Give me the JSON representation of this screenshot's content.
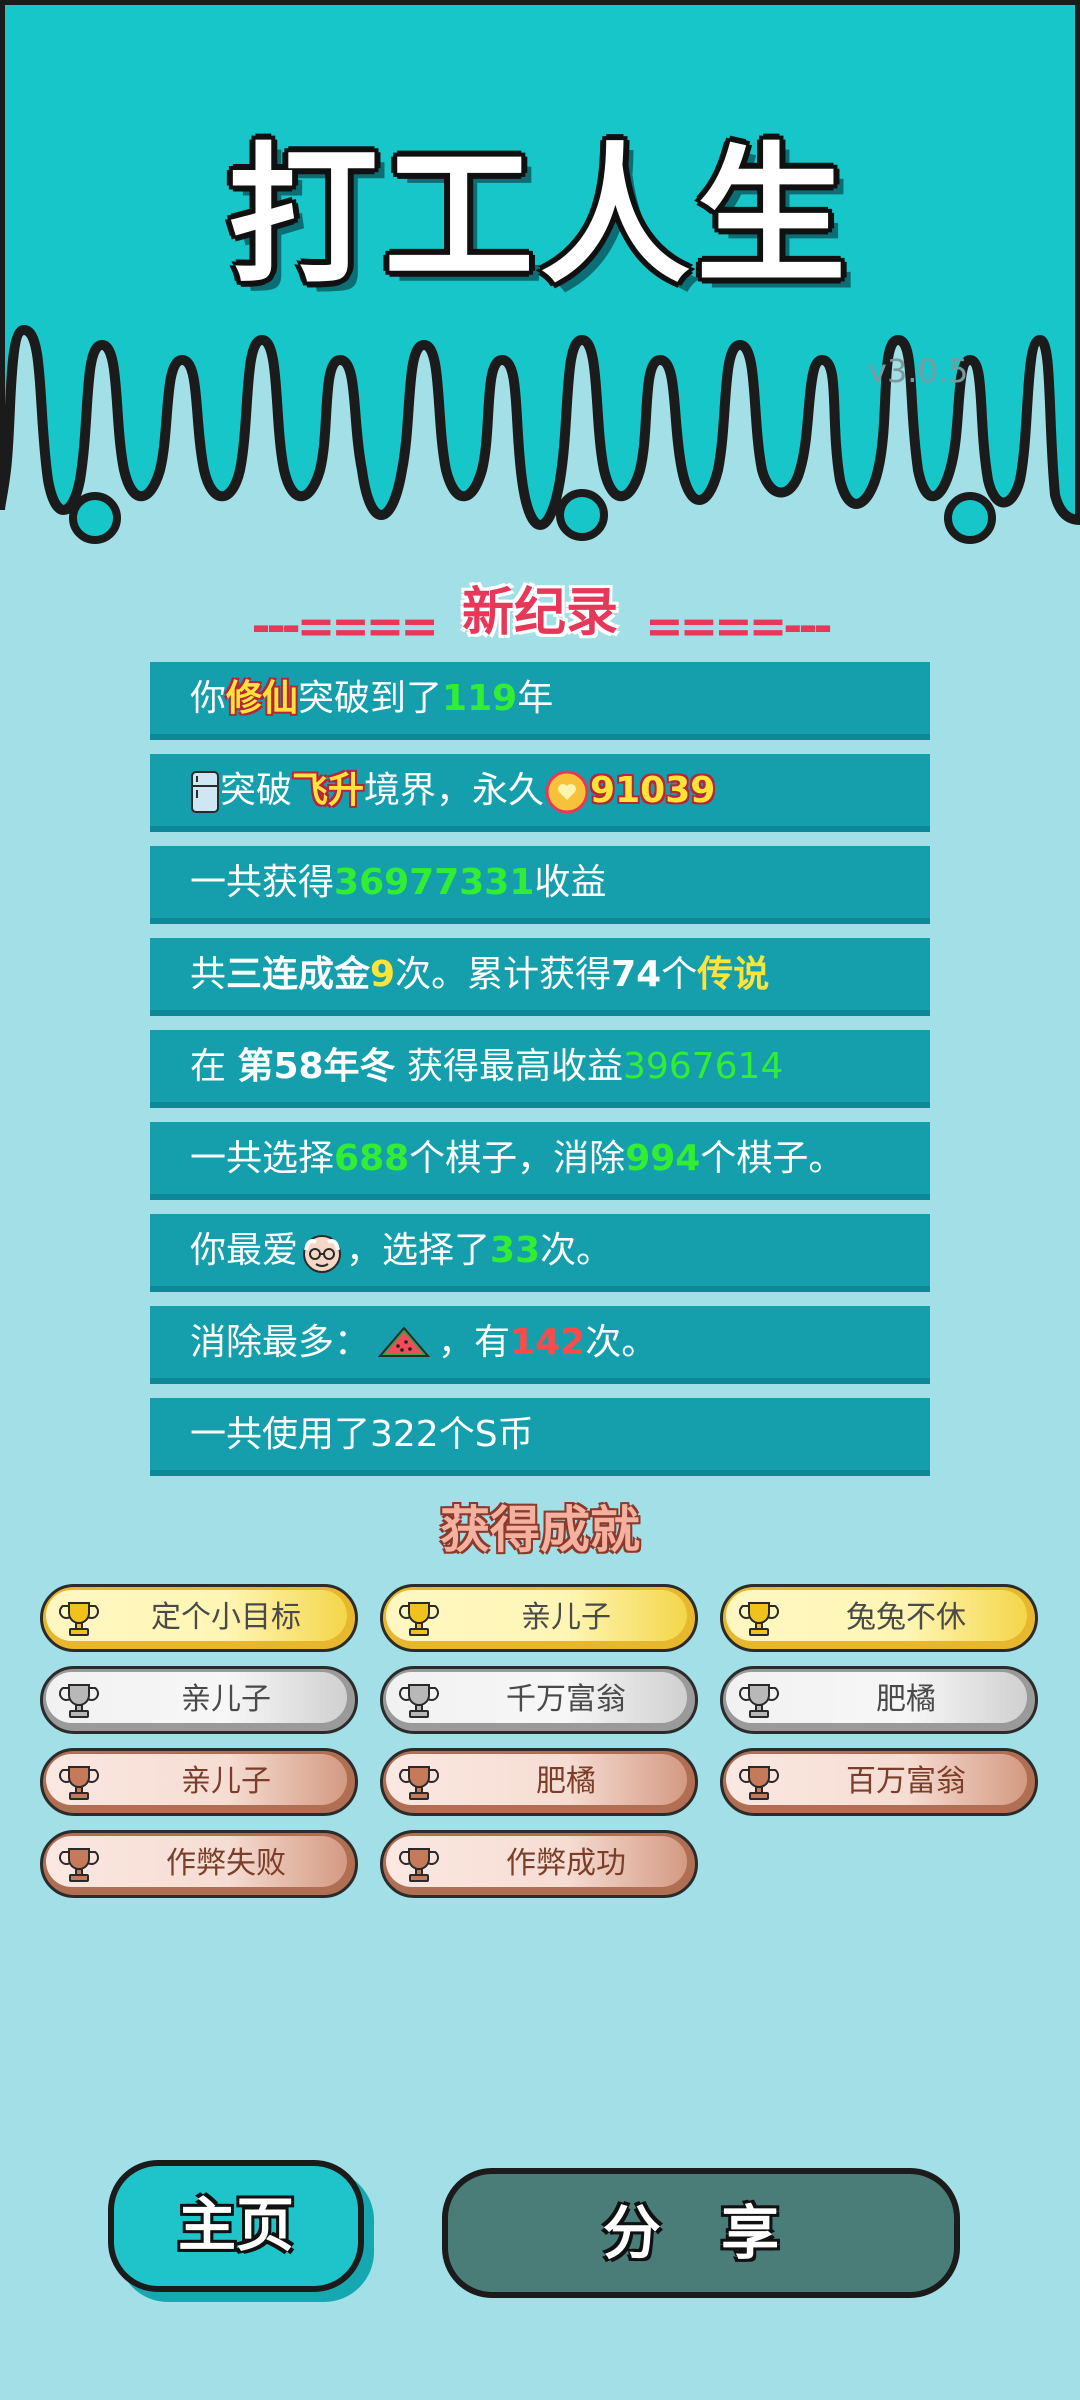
{
  "header": {
    "title": "打工人生",
    "version": "v3.0.5"
  },
  "record": {
    "title": "新纪录",
    "dash_left": "---====",
    "dash_right": "====---"
  },
  "stats": {
    "r1": {
      "a": "你",
      "b": "修仙",
      "c": "突破到了",
      "d": "119",
      "e": "年"
    },
    "r2": {
      "b": "突破",
      "c": "飞升",
      "d": "境界，永久",
      "e": "91039"
    },
    "r3": {
      "a": "一共获得",
      "b": "36977331",
      "c": "收益"
    },
    "r4": {
      "a": "共",
      "b": "三连成金",
      "c": "9",
      "d": "次。累计获得",
      "e": "74",
      "f": "个",
      "g": "传说"
    },
    "r5": {
      "a": "在 ",
      "b": "第58年冬",
      "c": " 获得最高收益",
      "d": "3967614"
    },
    "r6": {
      "a": "一共选择",
      "b": "688",
      "c": "个棋子，消除",
      "d": "994",
      "e": "个棋子。"
    },
    "r7": {
      "a": "你最爱",
      "b": "，选择了",
      "c": "33",
      "d": "次。"
    },
    "r8": {
      "a": "消除最多：",
      "b": "，有",
      "c": "142",
      "d": "次。"
    },
    "r9": {
      "a": "一共使用了322个S币"
    }
  },
  "achievements": {
    "title": "获得成就",
    "items": [
      {
        "label": "定个小目标",
        "tier": "gold"
      },
      {
        "label": "亲儿子",
        "tier": "gold"
      },
      {
        "label": "兔兔不休",
        "tier": "gold"
      },
      {
        "label": "亲儿子",
        "tier": "silver"
      },
      {
        "label": "千万富翁",
        "tier": "silver"
      },
      {
        "label": "肥橘",
        "tier": "silver"
      },
      {
        "label": "亲儿子",
        "tier": "bronze"
      },
      {
        "label": "肥橘",
        "tier": "bronze"
      },
      {
        "label": "百万富翁",
        "tier": "bronze"
      },
      {
        "label": "作弊失败",
        "tier": "bronze"
      },
      {
        "label": "作弊成功",
        "tier": "bronze"
      }
    ]
  },
  "buttons": {
    "home": "主页",
    "share": "分 享"
  },
  "colors": {
    "header_bg": "#16c6c9",
    "page_bg": "#a2dfe6",
    "row_bg": "#159fac",
    "accent_red": "#e8385a"
  }
}
